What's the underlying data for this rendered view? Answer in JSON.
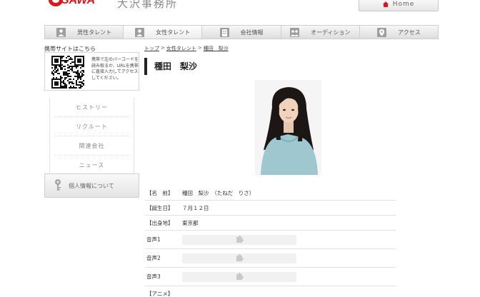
{
  "header": {
    "logo_text": "OSAWA",
    "site_name": "大沢事務所",
    "home_label": "Home"
  },
  "nav": {
    "items": [
      {
        "label": "男性タレント",
        "icon": "person-icon",
        "active": false
      },
      {
        "label": "女性タレント",
        "icon": "person-icon",
        "active": true
      },
      {
        "label": "会社情報",
        "icon": "building-icon",
        "active": false
      },
      {
        "label": "オーディション",
        "icon": "group-icon",
        "active": false
      },
      {
        "label": "アクセス",
        "icon": "map-pin-icon",
        "active": false
      }
    ]
  },
  "sidebar": {
    "mobile_title": "携帯サイトはこちら",
    "qr_text": "携帯で左のバーコードを読み取るか、URLを携帯に直接入力してアクセスしてください。",
    "menu": [
      {
        "label": "ヒストリー"
      },
      {
        "label": "リクルート"
      },
      {
        "label": "関連会社"
      },
      {
        "label": "ニュース"
      }
    ],
    "privacy_label": "個人情報について"
  },
  "breadcrumb": {
    "items": [
      "トップ",
      "女性タレント",
      "種田　梨沙"
    ],
    "separator": ">"
  },
  "profile": {
    "name_title": "種田　梨沙",
    "rows": [
      {
        "label": "【名　前】",
        "value": "種田　梨沙　（たねだ　りさ）"
      },
      {
        "label": "【誕生日】",
        "value": "７月１２日"
      },
      {
        "label": "【出身地】",
        "value": "東京都"
      }
    ],
    "voice_rows": [
      {
        "label": "音声1",
        "icon": "puzzle-plugin-icon"
      },
      {
        "label": "音声2",
        "icon": "puzzle-plugin-icon"
      },
      {
        "label": "音声3",
        "icon": "puzzle-plugin-icon"
      }
    ],
    "next_label": "【アニメ】"
  },
  "colors": {
    "brand_red": "#d9171f",
    "nav_bg": "#e3e3e3",
    "title_bar": "#222222"
  }
}
